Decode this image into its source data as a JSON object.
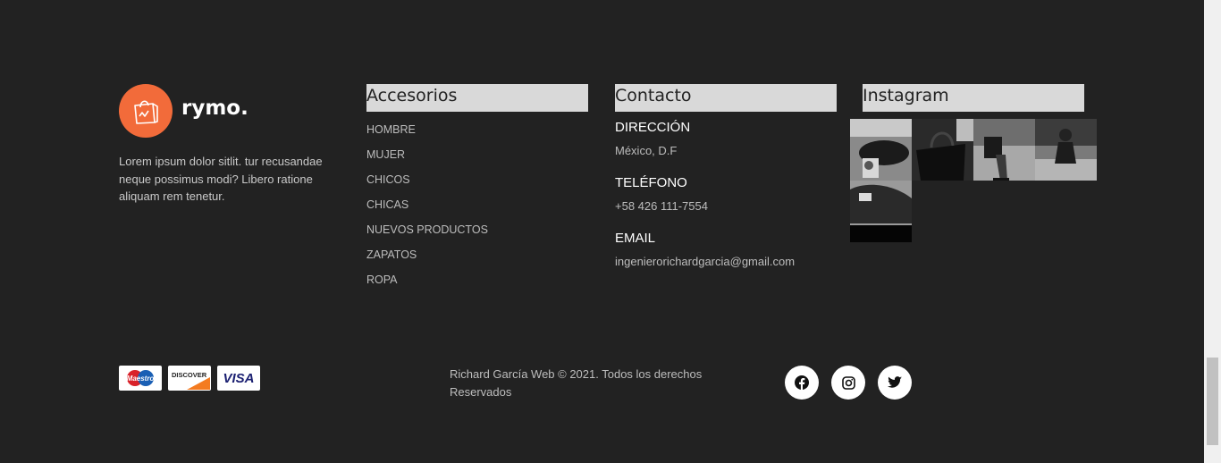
{
  "brand": {
    "name": "rymo.",
    "description": "Lorem ipsum dolor sitlit. tur recusandae neque possimus modi? Libero ratione aliquam rem tenetur.",
    "logo_color": "#f26b3a"
  },
  "accessories": {
    "title": "Accesorios",
    "items": [
      "HOMBRE",
      "MUJER",
      "CHICOS",
      "CHICAS",
      "NUEVOS PRODUCTOS",
      "ZAPATOS",
      "ROPA"
    ]
  },
  "contact": {
    "title": "Contacto",
    "address_label": "DIRECCIÓN",
    "address_value": "México, D.F",
    "phone_label": "TELÉFONO",
    "phone_value": "+58 426 111-7554",
    "email_label": "EMAIL",
    "email_value": "ingenierorichardgarcia@gmail.com"
  },
  "instagram": {
    "title": "Instagram",
    "photos": [
      "watch-bag-photo",
      "handbag-photo",
      "quilted-bag-photo",
      "woman-sitting-photo",
      "cap-photo"
    ]
  },
  "payments": {
    "cards": [
      "Maestro",
      "DISCOVER",
      "VISA"
    ]
  },
  "footer": {
    "copyright": "Richard García Web © 2021. Todos los derechos Reservados"
  },
  "social": {
    "icons": [
      "facebook-icon",
      "instagram-icon",
      "twitter-icon"
    ]
  },
  "colors": {
    "background": "#222222",
    "accent": "#f26b3a",
    "title_bar": "#d9d9d9"
  }
}
